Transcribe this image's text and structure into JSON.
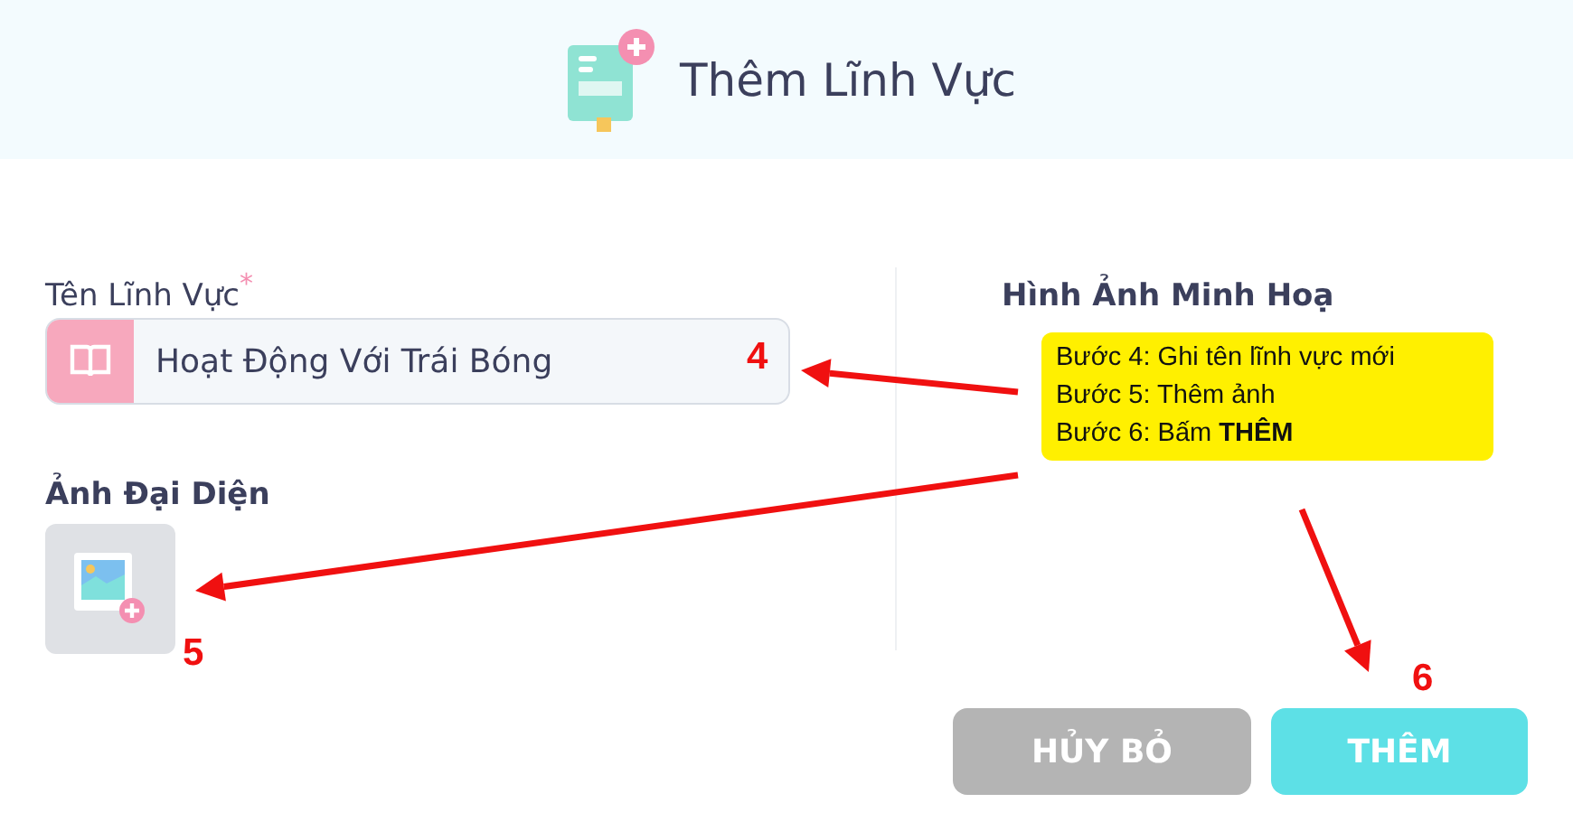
{
  "header": {
    "title": "Thêm Lĩnh Vực"
  },
  "name_field": {
    "label": "Tên Lĩnh Vực",
    "required_mark": "*",
    "value": "Hoạt Động Với Trái Bóng"
  },
  "avatar": {
    "label": "Ảnh Đại Diện"
  },
  "illustration": {
    "heading": "Hình Ảnh Minh Hoạ"
  },
  "callout": {
    "lines": [
      "Bước 4: Ghi tên lĩnh vực mới",
      "Bước 5: Thêm ảnh",
      "Bước 6: Bấm **THÊM**"
    ]
  },
  "step_markers": [
    "4",
    "5",
    "6"
  ],
  "buttons": [
    {
      "label": "HỦY BỎ",
      "kind": "cancel"
    },
    {
      "label": "THÊM",
      "kind": "primary"
    }
  ]
}
